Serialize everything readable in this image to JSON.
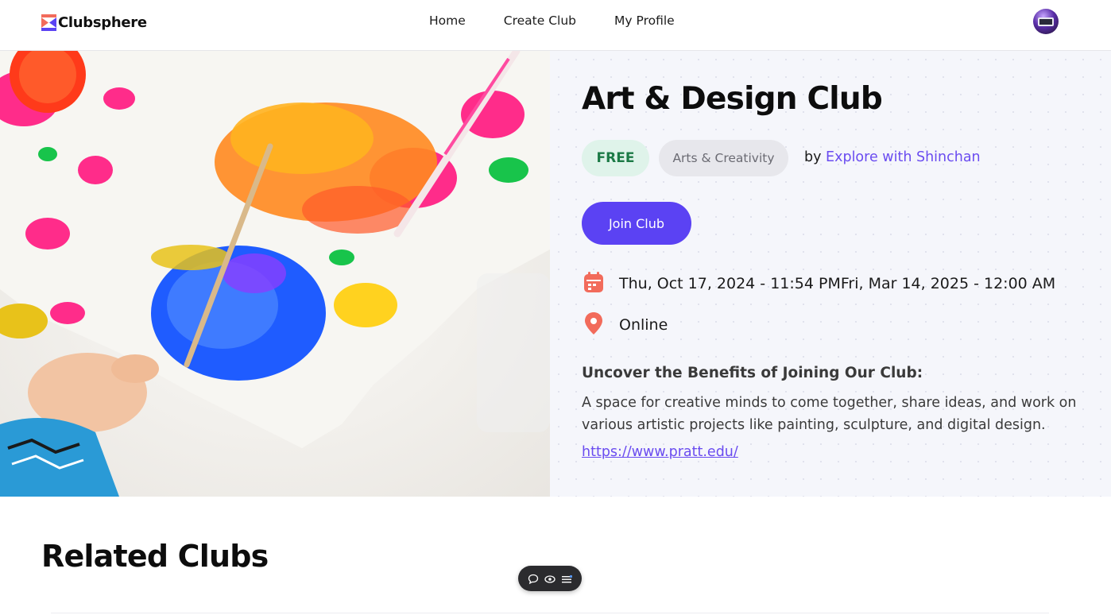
{
  "header": {
    "brand": "Clubsphere",
    "nav": [
      "Home",
      "Create Club",
      "My Profile"
    ]
  },
  "club": {
    "title": "Art & Design Club",
    "price_badge": "FREE",
    "category": "Arts & Creativity",
    "by_label": "by",
    "organizer": "Explore with Shinchan",
    "join_label": "Join Club",
    "date_range": "Thu, Oct 17, 2024 - 11:54 PMFri, Mar 14, 2025 - 12:00 AM",
    "location": "Online",
    "benefits_heading": "Uncover the Benefits of Joining Our Club:",
    "description": "A space for creative minds to come together, share ideas, and work on various artistic projects like painting, sculpture, and digital design.",
    "url": "https://www.pratt.edu/"
  },
  "related": {
    "heading": "Related Clubs"
  },
  "icons": {
    "calendar": "calendar-icon",
    "location": "location-pin-icon",
    "toolbar": [
      "comment-icon",
      "eye-icon",
      "menu-icon"
    ]
  },
  "colors": {
    "accent": "#5b42f3",
    "link": "#6a4cf0",
    "free_bg": "#dff3ea",
    "free_text": "#1c7a46",
    "icon_coral": "#f26b5b"
  }
}
